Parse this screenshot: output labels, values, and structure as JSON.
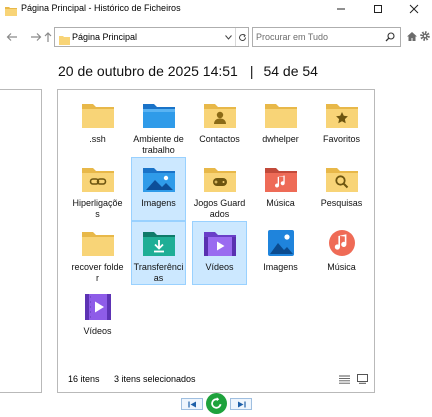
{
  "window": {
    "title": "Página Principal - Histórico de Ficheiros",
    "controls": [
      "minimize",
      "maximize",
      "close"
    ]
  },
  "toolbar": {
    "address": "Página Principal",
    "search_placeholder": "Procurar em Tudo",
    "icons": [
      "back-arrow",
      "forward-arrow",
      "up-arrow",
      "home",
      "gear"
    ]
  },
  "header": {
    "date": "20 de outubro de 2025 14:51",
    "separator": "|",
    "position": "54 de 54"
  },
  "items": [
    {
      "label": ".ssh",
      "icon": "folder",
      "selected": false
    },
    {
      "label": "Ambiente de trabalho",
      "icon": "desktop-folder",
      "selected": false
    },
    {
      "label": "Contactos",
      "icon": "contacts-folder",
      "selected": false
    },
    {
      "label": "dwhelper",
      "icon": "folder",
      "selected": false
    },
    {
      "label": "Favoritos",
      "icon": "favorites-folder",
      "selected": false
    },
    {
      "label": "Hiperligações",
      "icon": "links-folder",
      "selected": false
    },
    {
      "label": "Imagens",
      "icon": "pictures-folder",
      "selected": true
    },
    {
      "label": "Jogos Guardados",
      "icon": "games-folder",
      "selected": false
    },
    {
      "label": "Música",
      "icon": "music-folder",
      "selected": false
    },
    {
      "label": "Pesquisas",
      "icon": "searches-folder",
      "selected": false
    },
    {
      "label": "recover folder",
      "icon": "folder",
      "selected": false
    },
    {
      "label": "Transferências",
      "icon": "downloads-folder",
      "selected": true
    },
    {
      "label": "Vídeos",
      "icon": "videos-folder",
      "selected": true
    },
    {
      "label": "Imagens",
      "icon": "pictures-library",
      "selected": false
    },
    {
      "label": "Música",
      "icon": "music-library",
      "selected": false
    },
    {
      "label": "Vídeos",
      "icon": "videos-library",
      "selected": false
    }
  ],
  "status": {
    "count": "16 itens",
    "selected": "3 itens selecionados"
  },
  "colors": {
    "folder": "#f8d477",
    "folder_dark": "#e8b849",
    "selection": "#cce8ff",
    "selection_border": "#99d1ff",
    "restore": "#1ea23c"
  }
}
